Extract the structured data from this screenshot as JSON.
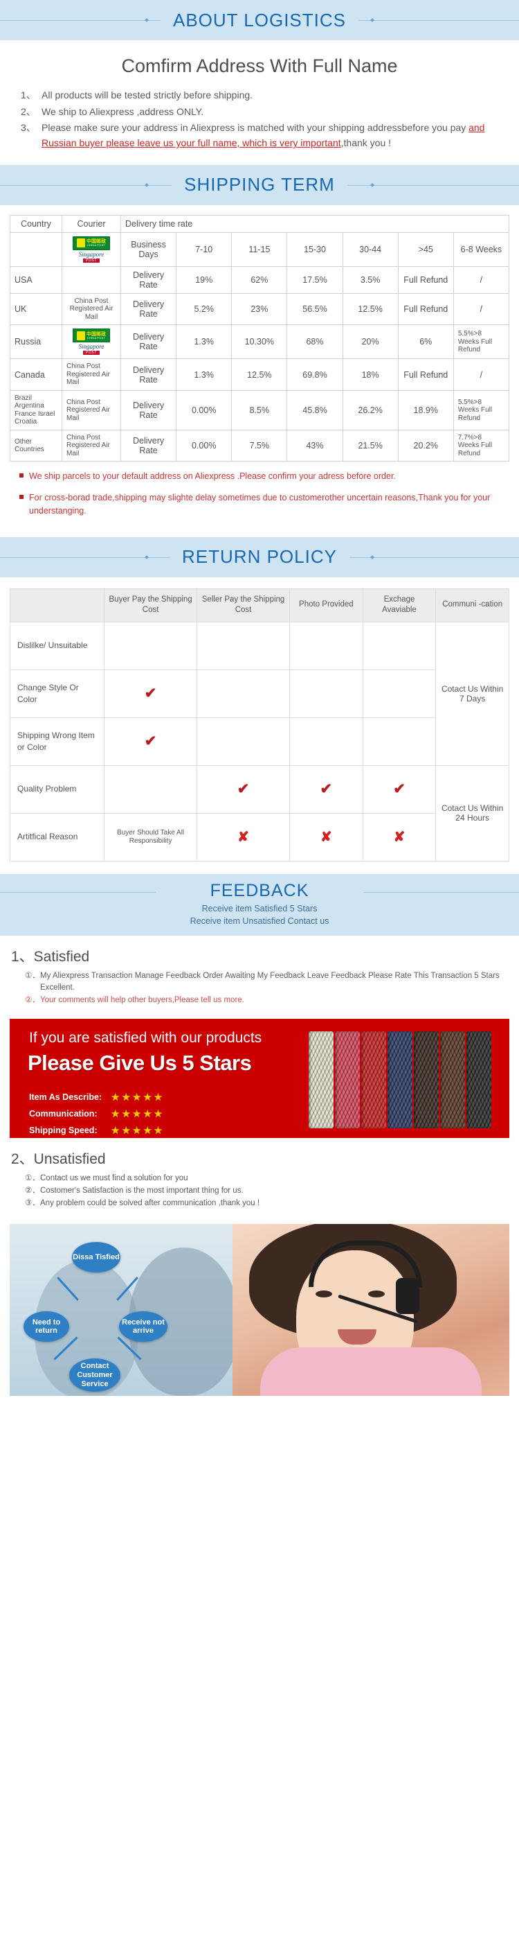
{
  "sections": {
    "about": {
      "banner_title": "ABOUT LOGISTICS",
      "heading": "Comfirm  Address With Full Name",
      "notes": [
        {
          "num": "1、",
          "text": "All products will be tested strictly before shipping."
        },
        {
          "num": "2、",
          "text": "We ship to Aliexpress ,address ONLY."
        },
        {
          "num": "3、",
          "part1": "Please make sure your address in Aliexpress is matched with your shipping addressbefore you pay ",
          "red1": "and Russian buyer please leave us your full name, which is very important",
          "part2": ",thank you !"
        }
      ]
    },
    "shipping": {
      "banner_title": "SHIPPING TERM",
      "headers": {
        "country": "Country",
        "courier": "Courier",
        "delivery_time_rate": "Delivery time rate"
      },
      "time_row": {
        "label": "Business Days",
        "buckets": [
          "7-10",
          "11-15",
          "15-30",
          "30-44",
          ">45",
          "6-8 Weeks"
        ]
      },
      "rows": [
        {
          "country": "USA",
          "courier": "",
          "courier_logo": "none",
          "rate_label": "Delivery Rate",
          "values": [
            "19%",
            "62%",
            "17.5%",
            "3.5%",
            "Full Refund",
            "/"
          ]
        },
        {
          "country": "UK",
          "courier": "China Post Registered Air Mail",
          "courier_logo": "none",
          "rate_label": "Delivery Rate",
          "values": [
            "5.2%",
            "23%",
            "56.5%",
            "12.5%",
            "Full Refund",
            "/"
          ]
        },
        {
          "country": "Russia",
          "courier": "",
          "courier_logo": "china-post-singapore-post",
          "rate_label": "Delivery Rate",
          "values": [
            "1.3%",
            "10.30%",
            "68%",
            "20%",
            "6%",
            "5.5%>8 Weeks Full Refund"
          ]
        },
        {
          "country": "Canada",
          "courier": "China Post Registered Air Mail",
          "courier_logo": "none",
          "rate_label": "Delivery Rate",
          "values": [
            "1.3%",
            "12.5%",
            "69.8%",
            "18%",
            "Full Refund",
            "/"
          ]
        },
        {
          "country": "Brazil Argentina France Israel Croatia",
          "courier": "China Post Registered Air Mail",
          "courier_logo": "none",
          "rate_label": "Delivery Rate",
          "values": [
            "0.00%",
            "8.5%",
            "45.8%",
            "26.2%",
            "18.9%",
            "5.5%>8 Weeks Full Refund"
          ]
        },
        {
          "country": "Other Countries",
          "courier": "China Post Registered Air Mail",
          "courier_logo": "none",
          "rate_label": "Delivery Rate",
          "values": [
            "0.00%",
            "7.5%",
            "43%",
            "21.5%",
            "20.2%",
            "7.7%>8 Weeks Full Refund"
          ]
        }
      ],
      "bullets": [
        "We ship parcels to your default address on Aliexpress .Please confirm your adress before order.",
        "For cross-borad trade,shipping may slighte delay sometimes due to customerother uncertain reasons,Thank you for your understanging."
      ]
    },
    "return": {
      "banner_title": "RETURN POLICY",
      "headers": [
        "",
        "Buyer Pay the Shipping Cost",
        "Seller Pay the Shipping Cost",
        "Photo Provided",
        "Exchage Avaviable",
        "Communi -cation"
      ],
      "rows": [
        {
          "label": "Dislilke/ Unsuitable",
          "cells": [
            "",
            "",
            "",
            ""
          ]
        },
        {
          "label": "Change Style Or Color",
          "cells": [
            "check",
            "",
            "",
            ""
          ]
        },
        {
          "label": "Shipping Wrong Item or Color",
          "cells": [
            "check",
            "",
            "",
            ""
          ]
        },
        {
          "label": "Quality Problem",
          "cells": [
            "",
            "check",
            "check",
            "check"
          ]
        },
        {
          "label": "Artitfical Reason",
          "cells": [
            "Buyer Should Take All Responsibility",
            "cross",
            "cross",
            "cross"
          ]
        }
      ],
      "comm_group_1": "Cotact  Us Within 7 Days",
      "comm_group_2": "Cotact  Us Within 24 Hours",
      "check_glyph": "✔",
      "cross_glyph": "✘"
    },
    "feedback": {
      "banner_title": "FEEDBACK",
      "sub1": "Receive item Satisfied 5 Stars",
      "sub2": "Receive item Unsatisfied Contact us",
      "satisfied": {
        "heading": "1、Satisfied",
        "items": [
          {
            "num": "①．",
            "text": "My Aliexpress Transaction Manage Feedback Order Awaiting My Feedback Leave Feedback Please Rate This Transaction 5 Stars Excellent."
          },
          {
            "num": "②．",
            "text": "Your comments will help other buyers,Please tell us more.",
            "red": true
          }
        ]
      },
      "promo": {
        "line1": "If you are satisfied with our products",
        "line2": "Please Give Us 5 Stars",
        "rows": [
          {
            "label": "Item As Describe:",
            "stars": "★★★★★"
          },
          {
            "label": "Communication:",
            "stars": "★★★★★"
          },
          {
            "label": "Shipping Speed:",
            "stars": "★★★★★"
          }
        ]
      },
      "unsatisfied": {
        "heading": "2、Unsatisfied",
        "items": [
          {
            "num": "①．",
            "text": "Contact us we must find a solution for you"
          },
          {
            "num": "②．",
            "text": "Costomer's Satisfaction is the most important thing for us."
          },
          {
            "num": "③．",
            "text": "Any problem could be solved after communication ,thank you !"
          }
        ]
      },
      "diagram": {
        "bubbles": [
          {
            "name": "dissatisfied",
            "text": "Dissa Tisfied"
          },
          {
            "name": "need-to-return",
            "text": "Need to return"
          },
          {
            "name": "receive-not-arrive",
            "text": "Receive not arrive"
          },
          {
            "name": "contact-customer-service",
            "text": "Contact Customer Service"
          }
        ]
      }
    }
  },
  "colors": {
    "banner_bg": "#cfe4f3",
    "banner_text": "#1668b3",
    "red": "#d32222",
    "promo_bg": "#cc0000",
    "star": "#ffcc00"
  }
}
